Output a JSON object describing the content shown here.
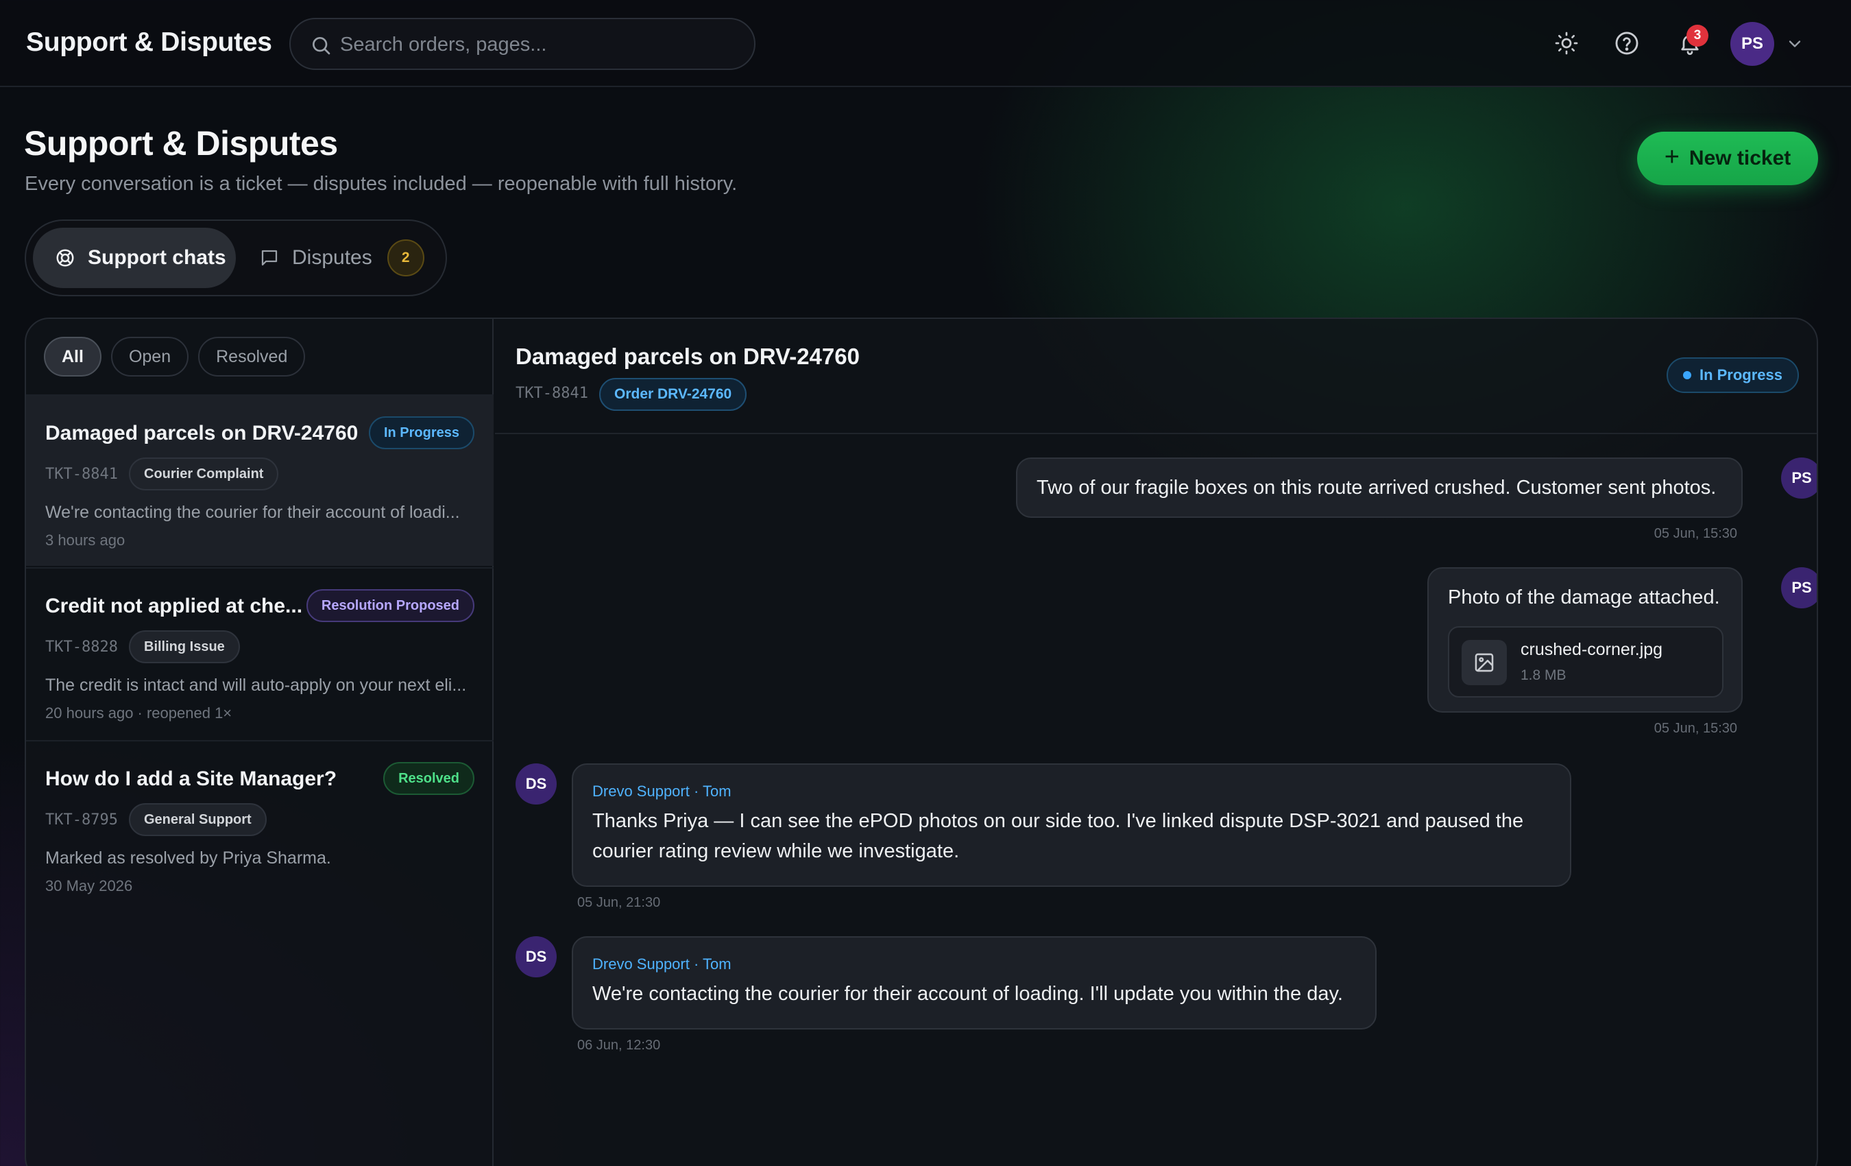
{
  "topbar": {
    "app_title": "Support & Disputes",
    "search_placeholder": "Search orders, pages...",
    "notifications_count": "3",
    "user_initials": "PS",
    "icons": [
      "sun-icon",
      "help-icon",
      "bell-icon",
      "chevron-down-icon"
    ]
  },
  "header": {
    "title": "Support & Disputes",
    "subtitle": "Every conversation is a ticket — disputes included — reopenable with full history.",
    "new_ticket_label": "New ticket"
  },
  "tabs": {
    "support_label": "Support chats",
    "disputes_label": "Disputes",
    "disputes_count": "2"
  },
  "filters": {
    "all": "All",
    "open": "Open",
    "resolved": "Resolved"
  },
  "tickets": [
    {
      "title": "Damaged parcels on DRV-24760",
      "status": "In Progress",
      "id": "TKT-8841",
      "category": "Courier Complaint",
      "preview": "We're contacting the courier for their account of loadi...",
      "time": "3 hours ago"
    },
    {
      "title": "Credit not applied at che...",
      "status": "Resolution Proposed",
      "id": "TKT-8828",
      "category": "Billing Issue",
      "preview": "The credit is intact and will auto-apply on your next eli...",
      "time": "20 hours ago · reopened 1×"
    },
    {
      "title": "How do I add a Site Manager?",
      "status": "Resolved",
      "id": "TKT-8795",
      "category": "General Support",
      "preview": "Marked as resolved by Priya Sharma.",
      "time": "30 May 2026"
    }
  ],
  "chat": {
    "title": "Damaged parcels on DRV-24760",
    "ticket_id": "TKT-8841",
    "order_chip": "Order DRV-24760",
    "status": "In Progress",
    "messages": [
      {
        "direction": "out",
        "avatar": "PS",
        "text": "Two of our fragile boxes on this route arrived crushed. Customer sent photos.",
        "time": "05 Jun, 15:30"
      },
      {
        "direction": "out",
        "avatar": "PS",
        "text": "Photo of the damage attached.",
        "attachment": {
          "name": "crushed-corner.jpg",
          "size": "1.8 MB"
        },
        "time": "05 Jun, 15:30"
      },
      {
        "direction": "in",
        "avatar": "DS",
        "sender": "Drevo Support · Tom",
        "text": "Thanks Priya — I can see the ePOD photos on our side too. I've linked dispute DSP-3021 and paused the courier rating review while we investigate.",
        "time": "05 Jun, 21:30"
      },
      {
        "direction": "in",
        "avatar": "DS",
        "sender": "Drevo Support · Tom",
        "text": "We're contacting the courier for their account of loading. I'll update you within the day.",
        "time": "06 Jun, 12:30"
      }
    ]
  },
  "colors": {
    "background": "#0a0d12",
    "accent_green": "#1fbb55",
    "info_blue": "#5cb8ff",
    "badge_red": "#e0323c",
    "dispute_amber": "#e8b93a",
    "avatar_purple": "#4a2a86"
  }
}
